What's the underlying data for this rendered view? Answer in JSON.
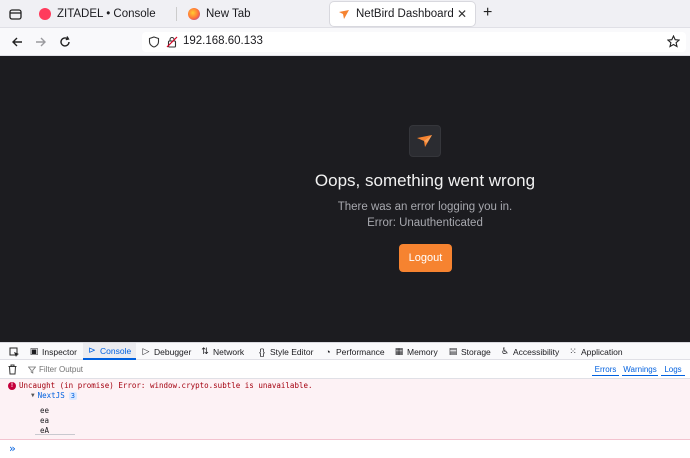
{
  "tabs": [
    {
      "label": "ZITADEL • Console",
      "favicon_color": "#ff3b5c",
      "active": false
    },
    {
      "label": "New Tab",
      "favicon_color": "#ff7139",
      "active": false
    },
    {
      "label": "NetBird Dashboard",
      "favicon_color": "#f68330",
      "active": true
    }
  ],
  "navbar": {
    "url": "192.168.60.133"
  },
  "page": {
    "title": "Oops, something went wrong",
    "message_line1": "There was an error logging you in.",
    "message_line2": "Error: Unauthenticated",
    "logout_label": "Logout",
    "accent_color": "#f68330"
  },
  "devtools": {
    "tabs": [
      {
        "label": "Inspector",
        "icon": "inspector-icon"
      },
      {
        "label": "Console",
        "icon": "console-icon"
      },
      {
        "label": "Debugger",
        "icon": "debugger-icon"
      },
      {
        "label": "Network",
        "icon": "network-icon"
      },
      {
        "label": "Style Editor",
        "icon": "style-editor-icon"
      },
      {
        "label": "Performance",
        "icon": "performance-icon"
      },
      {
        "label": "Memory",
        "icon": "memory-icon"
      },
      {
        "label": "Storage",
        "icon": "storage-icon"
      },
      {
        "label": "Accessibility",
        "icon": "accessibility-icon"
      },
      {
        "label": "Application",
        "icon": "application-icon"
      }
    ],
    "active_tab": "Console",
    "filter_placeholder": "Filter Output",
    "filter_buttons": [
      "Errors",
      "Warnings",
      "Logs"
    ],
    "console": {
      "error_message": "Uncaught (in promise) Error: window.crypto.subtle is unavailable.",
      "stack_group_label": "NextJS",
      "stack_group_count": "3",
      "frames": [
        "ee",
        "ea",
        "eA"
      ]
    },
    "prompt": "»"
  }
}
